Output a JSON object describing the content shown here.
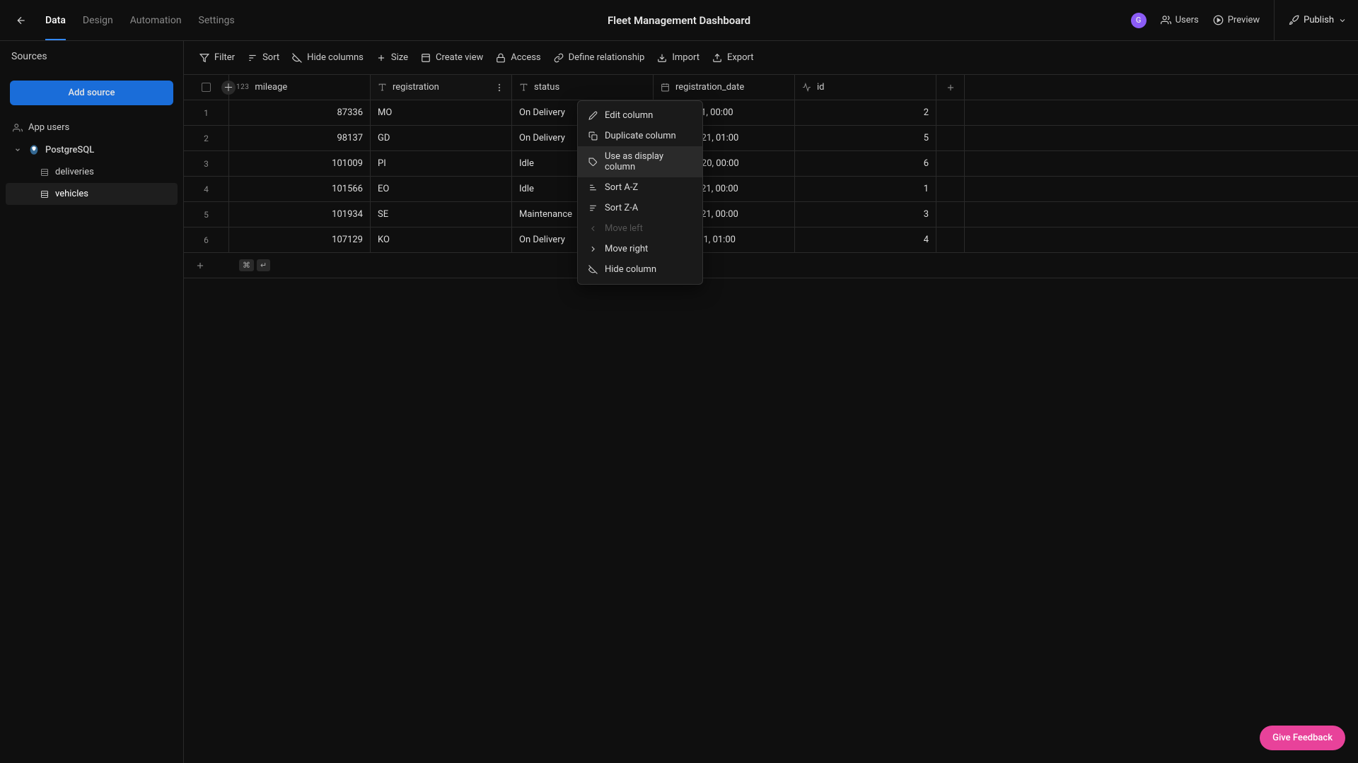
{
  "header": {
    "tabs": [
      "Data",
      "Design",
      "Automation",
      "Settings"
    ],
    "active_tab": "Data",
    "page_title": "Fleet Management Dashboard",
    "avatar_letter": "G",
    "users_label": "Users",
    "preview_label": "Preview",
    "publish_label": "Publish"
  },
  "sidebar": {
    "header": "Sources",
    "add_source_label": "Add source",
    "items": [
      {
        "label": "App users",
        "icon": "users"
      },
      {
        "label": "PostgreSQL",
        "icon": "postgres",
        "expanded": true
      },
      {
        "label": "deliveries",
        "icon": "table",
        "indent": 2
      },
      {
        "label": "vehicles",
        "icon": "table",
        "indent": 2,
        "selected": true
      }
    ]
  },
  "toolbar": [
    {
      "label": "Filter",
      "icon": "filter"
    },
    {
      "label": "Sort",
      "icon": "sort"
    },
    {
      "label": "Hide columns",
      "icon": "eye-off"
    },
    {
      "label": "Size",
      "icon": "plus"
    },
    {
      "label": "Create view",
      "icon": "window"
    },
    {
      "label": "Access",
      "icon": "lock"
    },
    {
      "label": "Define relationship",
      "icon": "link"
    },
    {
      "label": "Import",
      "icon": "import"
    },
    {
      "label": "Export",
      "icon": "export"
    }
  ],
  "columns": [
    {
      "name": "mileage",
      "type": "number",
      "type_label": "123"
    },
    {
      "name": "registration",
      "type": "text",
      "active": true
    },
    {
      "name": "status",
      "type": "text"
    },
    {
      "name": "registration_date",
      "type": "date"
    },
    {
      "name": "id",
      "type": "formula"
    }
  ],
  "rows": [
    {
      "idx": "1",
      "mileage": "87336",
      "registration_prefix": "MO",
      "status": "On Delivery",
      "registration_date": "Jan 7 2021, 00:00",
      "id": "2"
    },
    {
      "idx": "2",
      "mileage": "98137",
      "registration_prefix": "GD",
      "status": "On Delivery",
      "registration_date": "Sep 18 2021, 01:00",
      "id": "5"
    },
    {
      "idx": "3",
      "mileage": "101009",
      "registration_prefix": "PI",
      "status": "Idle",
      "registration_date": "Dec 15 2020, 00:00",
      "id": "6"
    },
    {
      "idx": "4",
      "mileage": "101566",
      "registration_prefix": "EO",
      "status": "Idle",
      "registration_date": "Jan 29 2021, 00:00",
      "id": "1"
    },
    {
      "idx": "5",
      "mileage": "101934",
      "registration_prefix": "SE",
      "status": "Maintenance",
      "registration_date": "Jan 28 2021, 00:00",
      "id": "3"
    },
    {
      "idx": "6",
      "mileage": "107129",
      "registration_prefix": "KO",
      "status": "On Delivery",
      "registration_date": "Jul 30 2021, 01:00",
      "id": "4"
    }
  ],
  "kbd_hint": {
    "key1": "⌘",
    "key2": "↵"
  },
  "context_menu": [
    {
      "label": "Edit column",
      "icon": "pencil"
    },
    {
      "label": "Duplicate column",
      "icon": "copy"
    },
    {
      "label": "Use as display column",
      "icon": "tag",
      "highlighted": true
    },
    {
      "label": "Sort A-Z",
      "icon": "sort-asc"
    },
    {
      "label": "Sort Z-A",
      "icon": "sort-desc"
    },
    {
      "label": "Move left",
      "icon": "chevron-left",
      "disabled": true
    },
    {
      "label": "Move right",
      "icon": "chevron-right"
    },
    {
      "label": "Hide column",
      "icon": "eye-off"
    }
  ],
  "feedback_label": "Give Feedback"
}
